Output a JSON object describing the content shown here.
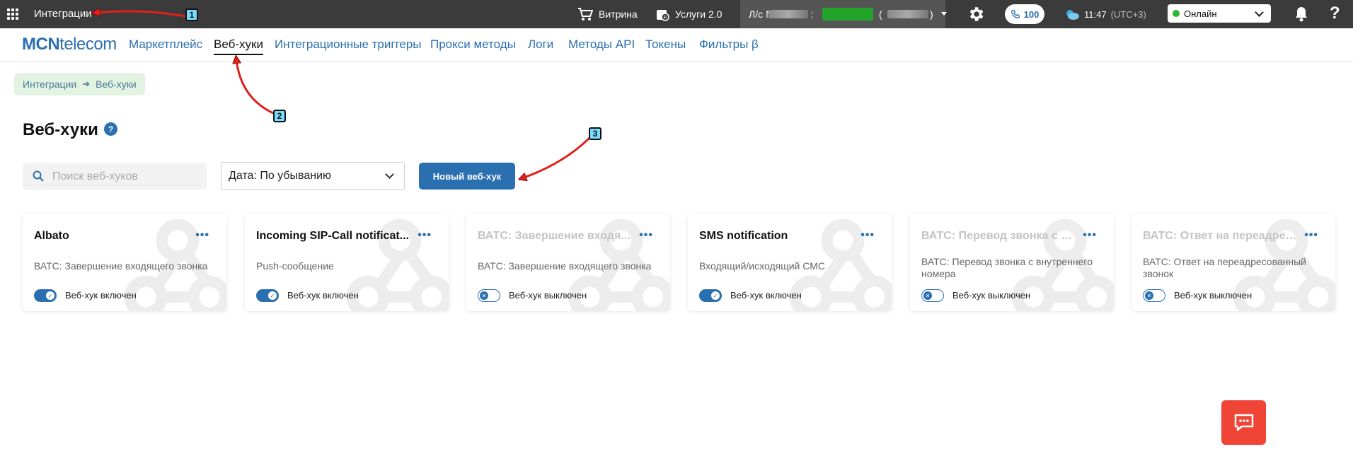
{
  "topbar": {
    "app_title": "Интеграции",
    "showcase_label": "Витрина",
    "services_label": "Услуги 2.0",
    "account_label": "Л/с №",
    "account_sep": ":",
    "account_paren_open": "(",
    "account_paren_close": ")",
    "calls_count": "100",
    "time": "11:47",
    "timezone": "(UTC+3)",
    "status_value": "Онлайн",
    "help": "?"
  },
  "brand": {
    "logo_bold": "MCN",
    "logo_rest": "telecom",
    "color": "#2a6fb0"
  },
  "nav": {
    "items": [
      {
        "label": "Маркетплейс"
      },
      {
        "label": "Веб-хуки"
      },
      {
        "label": "Интеграционные триггеры"
      },
      {
        "label": "Прокси методы"
      },
      {
        "label": "Логи"
      },
      {
        "label": "Методы API"
      },
      {
        "label": "Токены"
      },
      {
        "label": "Фильтры β"
      }
    ],
    "active_index": 1
  },
  "breadcrumb": {
    "items": [
      "Интеграции",
      "Веб-хуки"
    ],
    "separator": "➔"
  },
  "page": {
    "title": "Веб-хуки",
    "help_icon": "?"
  },
  "controls": {
    "search_placeholder": "Поиск веб-хуков",
    "sort_value": "Дата: По убыванию",
    "new_button": "Новый веб-хук"
  },
  "cards": [
    {
      "title": "Albato",
      "description": "ВАТС: Завершение входящего звонка",
      "enabled": true,
      "status": "Веб-хук включен"
    },
    {
      "title": "Incoming SIP-Call notificat...",
      "description": "Push-сообщение",
      "enabled": true,
      "status": "Веб-хук включен"
    },
    {
      "title": "ВАТС: Завершение входя...",
      "description": "ВАТС: Завершение входящего звонка",
      "enabled": false,
      "status": "Веб-хук выключен"
    },
    {
      "title": "SMS notification",
      "description": "Входящий/исходящий СМС",
      "enabled": true,
      "status": "Веб-хук включен"
    },
    {
      "title": "ВАТС: Перевод звонка с в...",
      "description": "ВАТС: Перевод звонка с внутреннего номера",
      "enabled": false,
      "status": "Веб-хук выключен"
    },
    {
      "title": "ВАТС: Ответ на переадрес...",
      "description": "ВАТС: Ответ на переадресованный звонок",
      "enabled": false,
      "status": "Веб-хук выключен"
    }
  ],
  "card_menu": "•••",
  "annotations": {
    "badge_1": "1",
    "badge_2": "2",
    "badge_3": "3"
  },
  "colors": {
    "accent": "#2a6fb0",
    "topbar": "#3b3b3b",
    "online": "#2eb82e",
    "chat": "#f04437",
    "annotation_arrow": "#e0201a"
  }
}
